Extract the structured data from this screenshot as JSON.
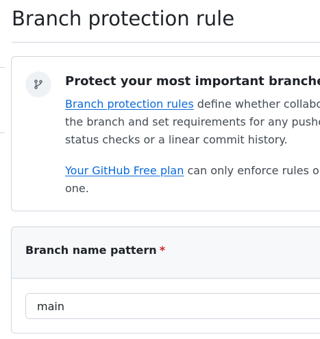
{
  "page": {
    "title": "Branch protection rule"
  },
  "info_card": {
    "icon": "git-branch-icon",
    "heading": "Protect your most important branches",
    "paragraph1": {
      "link": "Branch protection rules",
      "line1_rest": " define whether collabora",
      "line2": "the branch and set requirements for any pushes",
      "line3": "status checks or a linear commit history."
    },
    "paragraph2": {
      "link": "Your GitHub Free plan",
      "line1_rest": " can only enforce rules on",
      "line2": "one."
    }
  },
  "form": {
    "label": "Branch name pattern",
    "required_mark": "*",
    "input_value": "main"
  },
  "colors": {
    "link": "#0969da",
    "required": "#cf222e",
    "border": "#d0d7de",
    "header_bg": "#f6f8fa"
  }
}
